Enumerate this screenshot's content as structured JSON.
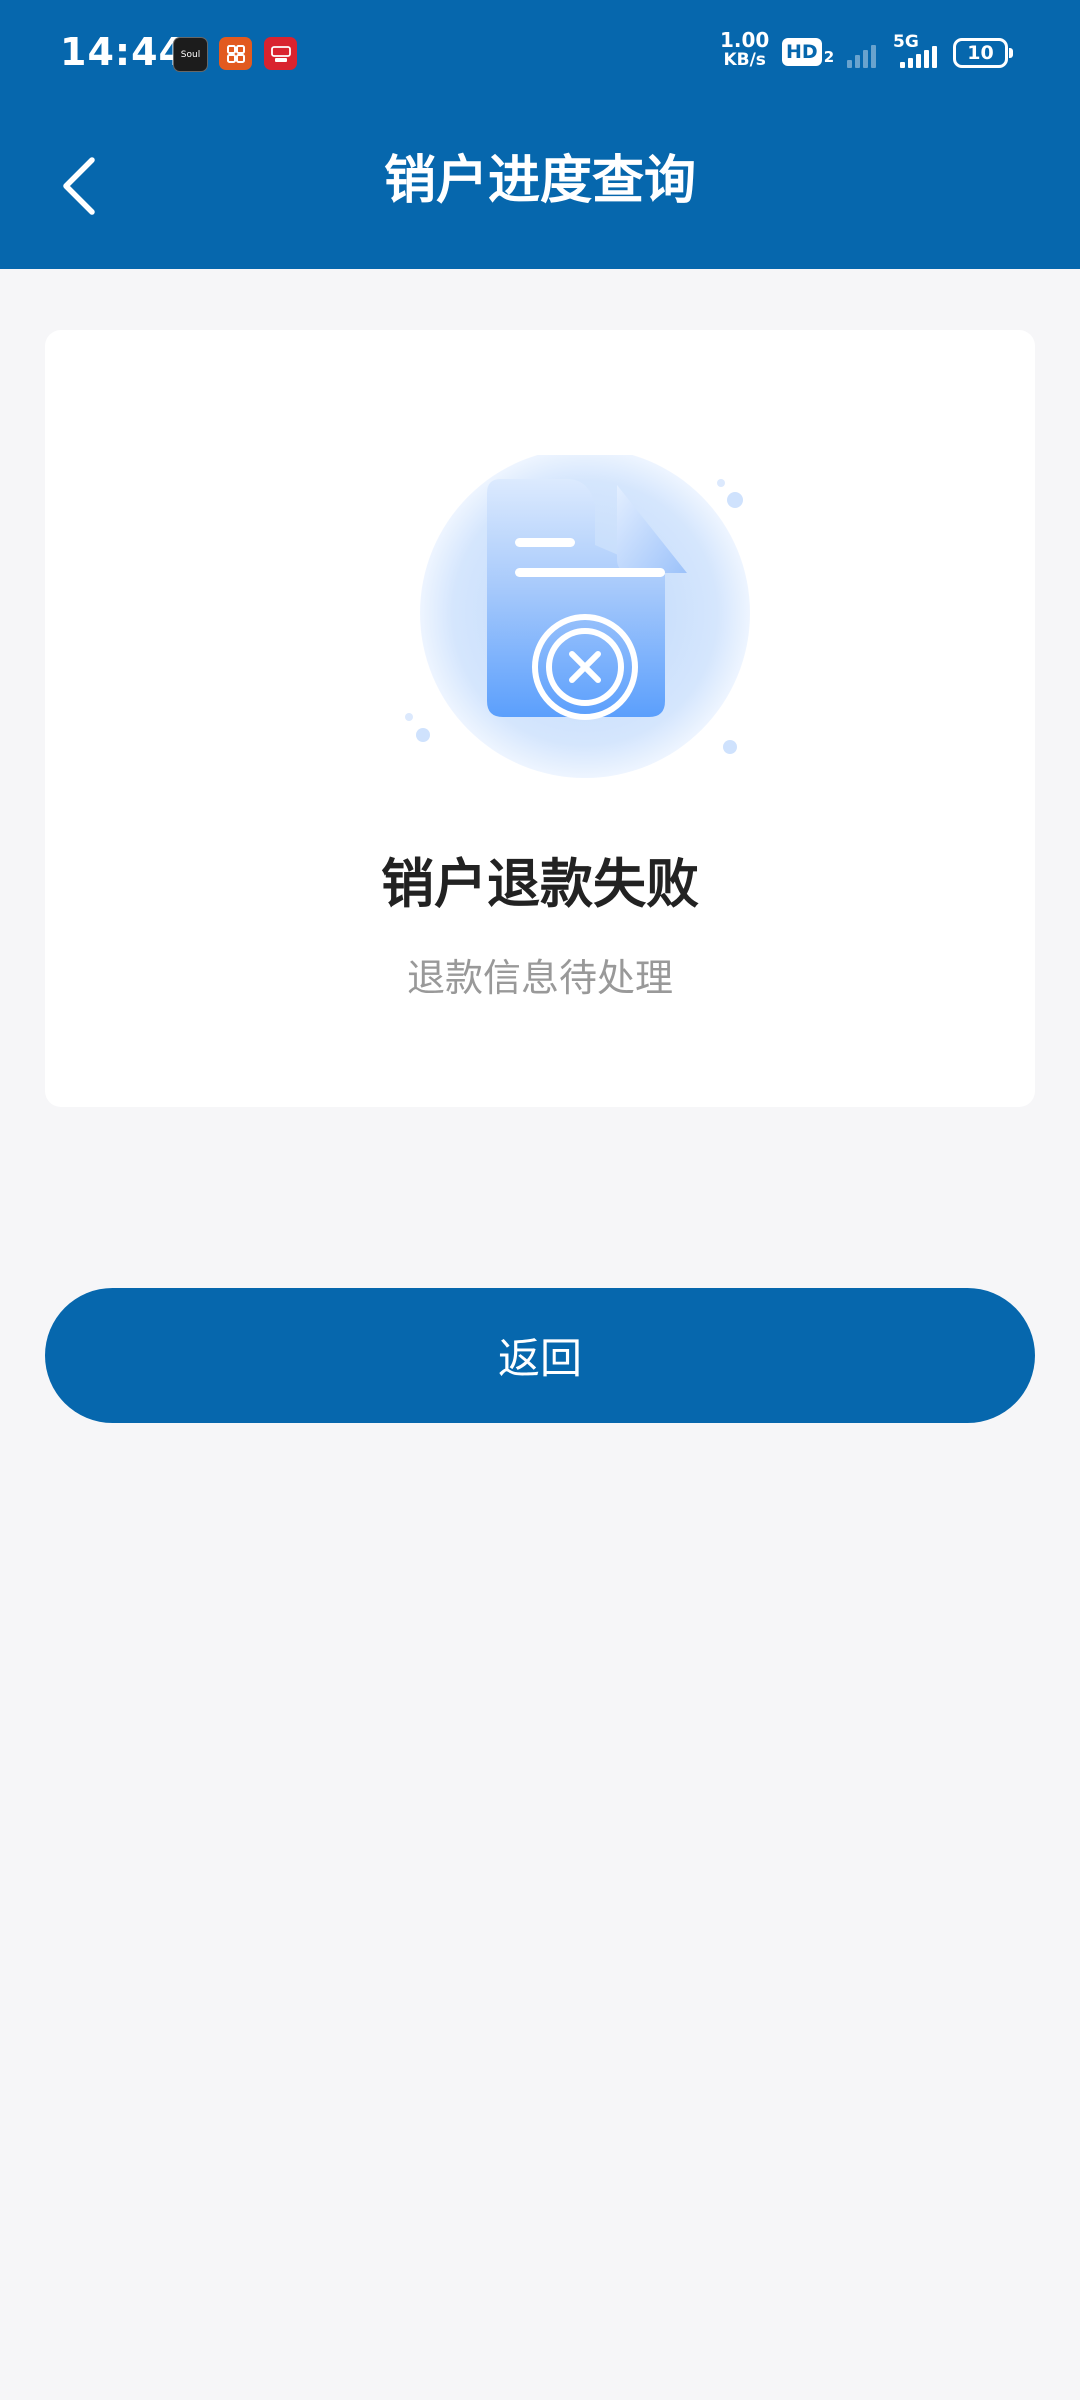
{
  "status_bar": {
    "time": "14:44",
    "apps": [
      "Soul",
      "小红书",
      "天猫"
    ],
    "net_speed_value": "1.00",
    "net_speed_unit": "KB/s",
    "hd_label": "HD",
    "hd_sub": "2",
    "network_type": "5G",
    "battery_level": "10"
  },
  "nav": {
    "title": "销户进度查询",
    "back_icon": "chevron-left-icon"
  },
  "result": {
    "icon": "document-error-icon",
    "title": "销户退款失败",
    "subtitle": "退款信息待处理"
  },
  "actions": {
    "return_label": "返回"
  },
  "colors": {
    "primary": "#0667ad",
    "page_background": "#f6f6f8",
    "card_background": "#ffffff",
    "title_text": "#222222",
    "subtitle_text": "#999999",
    "illustration_blue": "#5b9ffc"
  }
}
